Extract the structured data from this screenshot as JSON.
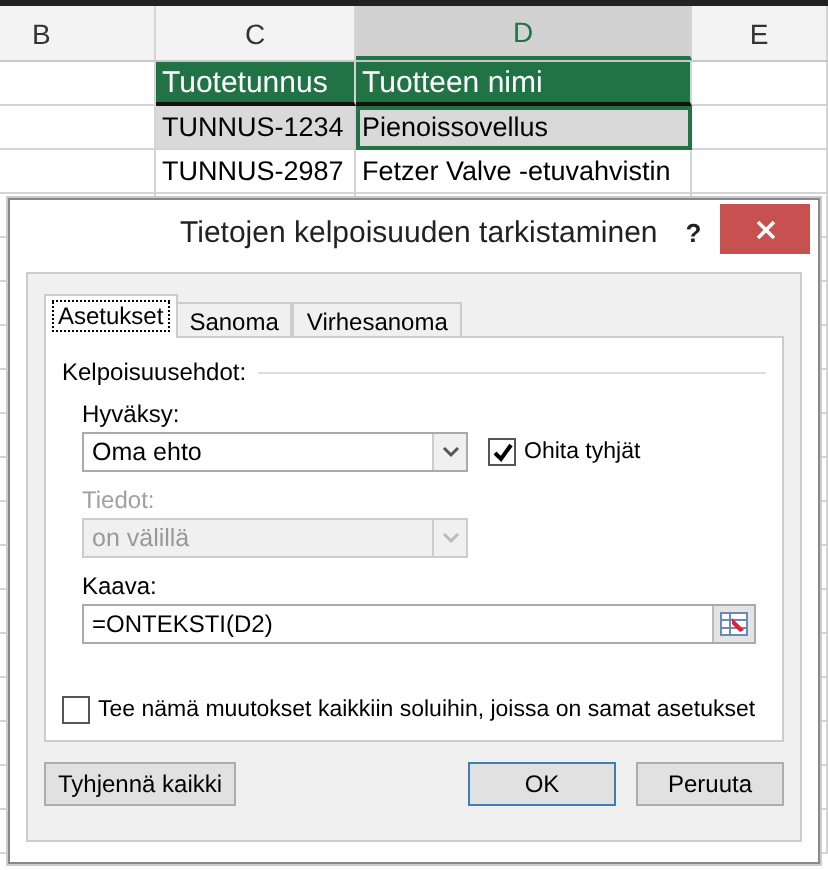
{
  "sheet": {
    "columns": [
      {
        "label": "B",
        "selected": false
      },
      {
        "label": "C",
        "selected": false
      },
      {
        "label": "D",
        "selected": true
      },
      {
        "label": "E",
        "selected": false
      }
    ],
    "rows": [
      [
        {
          "text": "",
          "kind": "plain"
        },
        {
          "text": "Tuotetunnus",
          "kind": "header"
        },
        {
          "text": "Tuotteen nimi",
          "kind": "header"
        },
        {
          "text": "",
          "kind": "plain"
        }
      ],
      [
        {
          "text": "",
          "kind": "plain"
        },
        {
          "text": "TUNNUS-1234",
          "kind": "band"
        },
        {
          "text": "Pienoissovellus",
          "kind": "active"
        },
        {
          "text": "",
          "kind": "plain"
        }
      ],
      [
        {
          "text": "",
          "kind": "plain"
        },
        {
          "text": "TUNNUS-2987",
          "kind": "plain"
        },
        {
          "text": "Fetzer Valve -etuvahvistin",
          "kind": "plain"
        },
        {
          "text": "",
          "kind": "plain"
        }
      ]
    ]
  },
  "dialog": {
    "title": "Tietojen kelpoisuuden tarkistaminen",
    "help": "?",
    "tabs": [
      {
        "label": "Asetukset",
        "selected": true
      },
      {
        "label": "Sanoma",
        "selected": false
      },
      {
        "label": "Virhesanoma",
        "selected": false
      }
    ],
    "section": "Kelpoisuusehdot:",
    "allow": {
      "label": "Hyväksy:",
      "value": "Oma ehto",
      "disabled": false
    },
    "ignore_blank": {
      "label": "Ohita tyhjät",
      "checked": true
    },
    "data": {
      "label": "Tiedot:",
      "value": "on välillä",
      "disabled": true
    },
    "formula": {
      "label": "Kaava:",
      "value": "=ONTEKSTI(D2)"
    },
    "apply_all": {
      "label": "Tee nämä muutokset kaikkiin soluihin, joissa on samat asetukset",
      "checked": false
    },
    "buttons": [
      {
        "label": "Tyhjennä kaikki",
        "kind": "clear"
      },
      {
        "label": "OK",
        "kind": "default"
      },
      {
        "label": "Peruuta",
        "kind": "normal"
      }
    ]
  }
}
